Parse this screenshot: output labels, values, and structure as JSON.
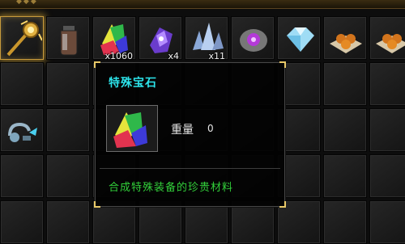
{
  "inventory": {
    "slots": [
      {
        "icon": "golden-staff-icon",
        "qty": "",
        "selected": true
      },
      {
        "icon": "potion-jar-icon",
        "qty": ""
      },
      {
        "icon": "special-gem-icon",
        "qty": "x1060"
      },
      {
        "icon": "purple-crystal-icon",
        "qty": "x4"
      },
      {
        "icon": "blue-crystal-cluster-icon",
        "qty": "x11"
      },
      {
        "icon": "purple-orb-rock-icon",
        "qty": ""
      },
      {
        "icon": "diamond-icon",
        "qty": ""
      },
      {
        "icon": "fireball-tray-icon",
        "qty": ""
      },
      {
        "icon": "fireball-tray-icon",
        "qty": ""
      }
    ],
    "row3_item": {
      "icon": "mechanical-pet-icon"
    }
  },
  "tooltip": {
    "title": "特殊宝石",
    "weight_label": "重量",
    "weight_value": "0",
    "description": "合成特殊装备的珍贵材料",
    "item_icon": "special-gem-icon"
  },
  "colors": {
    "title": "#2ce3ea",
    "description": "#32d03a",
    "corner_accent": "#e8c868"
  }
}
